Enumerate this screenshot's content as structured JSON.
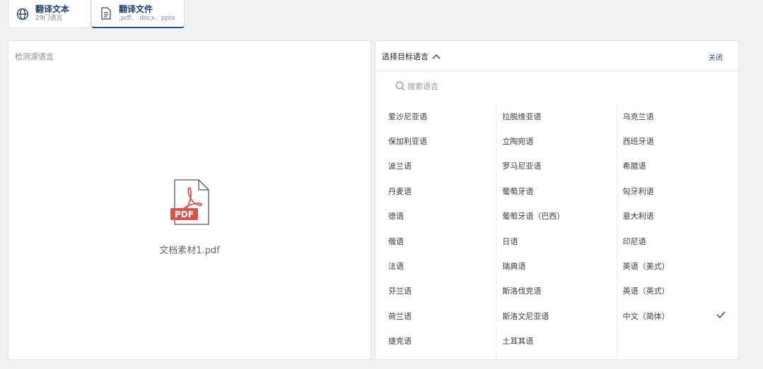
{
  "tabs": [
    {
      "title": "翻译文本",
      "subtitle": "29门语言",
      "icon": "globe-icon",
      "active": false
    },
    {
      "title": "翻译文件",
      "subtitle": ".pdf、.docx、pptx",
      "icon": "document-icon",
      "active": true
    }
  ],
  "left": {
    "detect_label": "检测源语言",
    "file_badge": "PDF",
    "file_name": "文档素材1.pdf"
  },
  "right": {
    "title": "选择目标语言",
    "close_label": "关闭",
    "search_placeholder": "搜索语言",
    "columns": [
      [
        "爱沙尼亚语",
        "保加利亚语",
        "波兰语",
        "丹麦语",
        "德语",
        "俄语",
        "法语",
        "芬兰语",
        "荷兰语",
        "捷克语"
      ],
      [
        "拉脱维亚语",
        "立陶宛语",
        "罗马尼亚语",
        "葡萄牙语",
        "葡萄牙语（巴西）",
        "日语",
        "瑞典语",
        "斯洛伐克语",
        "斯洛文尼亚语",
        "土耳其语"
      ],
      [
        "乌克兰语",
        "西班牙语",
        "希腊语",
        "匈牙利语",
        "意大利语",
        "印尼语",
        "英语（美式）",
        "英语（英式）",
        "中文（简体）"
      ]
    ],
    "selected": "中文（简体）"
  },
  "colors": {
    "accent": "#1d4f91",
    "pdf_red": "#d9534f",
    "check": "#1d4f91"
  }
}
